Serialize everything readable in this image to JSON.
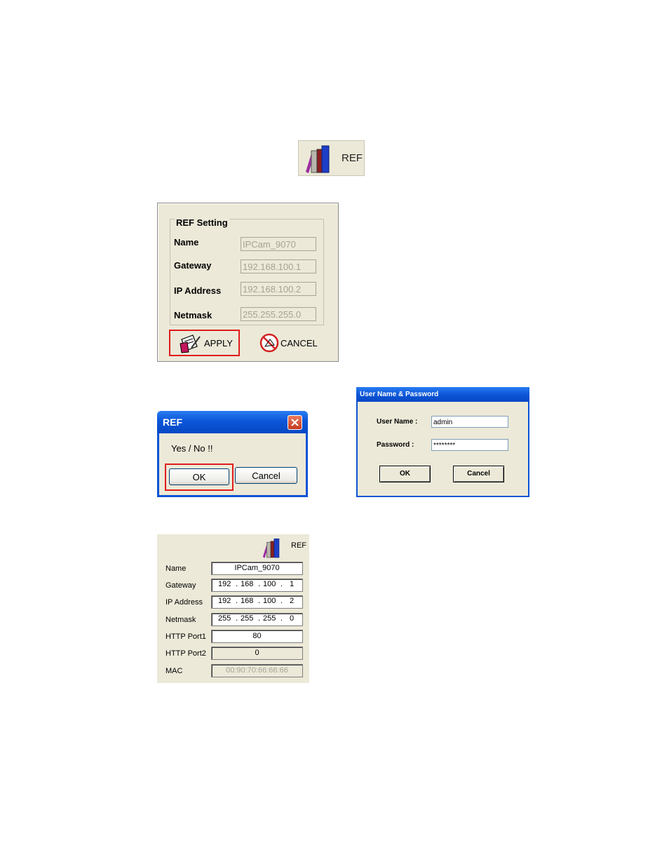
{
  "ref_button": {
    "label": "REF",
    "icon": "books-icon"
  },
  "ref_setting": {
    "title": "REF Setting",
    "rows": [
      {
        "label": "Name",
        "value": "IPCam_9070"
      },
      {
        "label": "Gateway",
        "value": "192.168.100.1"
      },
      {
        "label": "IP Address",
        "value": "192.168.100.2"
      },
      {
        "label": "Netmask",
        "value": "255.255.255.0"
      }
    ],
    "apply_label": "APPLY",
    "cancel_label": "CANCEL"
  },
  "confirm_dialog": {
    "title": "REF",
    "message": "Yes / No !!",
    "ok_label": "OK",
    "cancel_label": "Cancel"
  },
  "login_dialog": {
    "title": "User Name & Password",
    "username_label": "User Name :",
    "username_value": "admin",
    "password_label": "Password :",
    "password_value": "********",
    "ok_label": "OK",
    "cancel_label": "Cancel"
  },
  "network_panel": {
    "ref_label": "REF",
    "name_label": "Name",
    "name_value": "IPCam_9070",
    "gateway_label": "Gateway",
    "gateway": [
      "192",
      "168",
      "100",
      "1"
    ],
    "ip_label": "IP Address",
    "ip": [
      "192",
      "168",
      "100",
      "2"
    ],
    "netmask_label": "Netmask",
    "netmask": [
      "255",
      "255",
      "255",
      "0"
    ],
    "http1_label": "HTTP Port1",
    "http1_value": "80",
    "http2_label": "HTTP Port2",
    "http2_value": "0",
    "mac_label": "MAC",
    "mac_value": "00:90:70:66:66:66",
    "dot": "."
  },
  "colors": {
    "highlight": "#e11c1c",
    "xp_title": "#0c56d8",
    "panel_bg": "#ece9d8"
  }
}
